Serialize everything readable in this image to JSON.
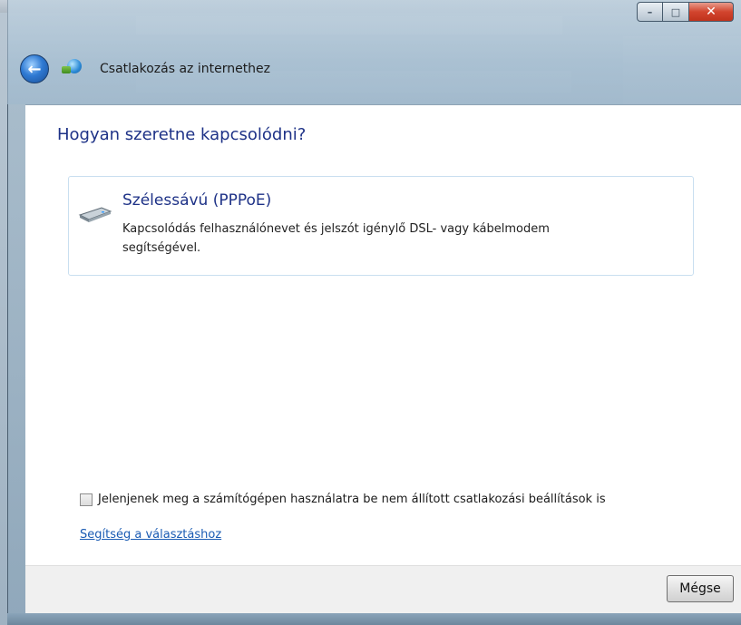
{
  "window": {
    "controls": {
      "minimize_icon": "–",
      "maximize_icon": "□",
      "close_icon": "✕"
    }
  },
  "nav": {
    "back_icon": "←",
    "title": "Csatlakozás az internethez"
  },
  "main": {
    "heading": "Hogyan szeretne kapcsolódni?",
    "option": {
      "title": "Szélessávú (PPPoE)",
      "description": "Kapcsolódás felhasználónevet és jelszót igénylő DSL- vagy kábelmodem segítségével.",
      "icon": "modem-icon"
    },
    "show_unconfigured": {
      "label": "Jelenjenek meg a számítógépen használatra be nem állított csatlakozási beállítások is",
      "checked": false
    },
    "help_link": "Segítség a választáshoz"
  },
  "footer": {
    "cancel_label": "Mégse"
  }
}
